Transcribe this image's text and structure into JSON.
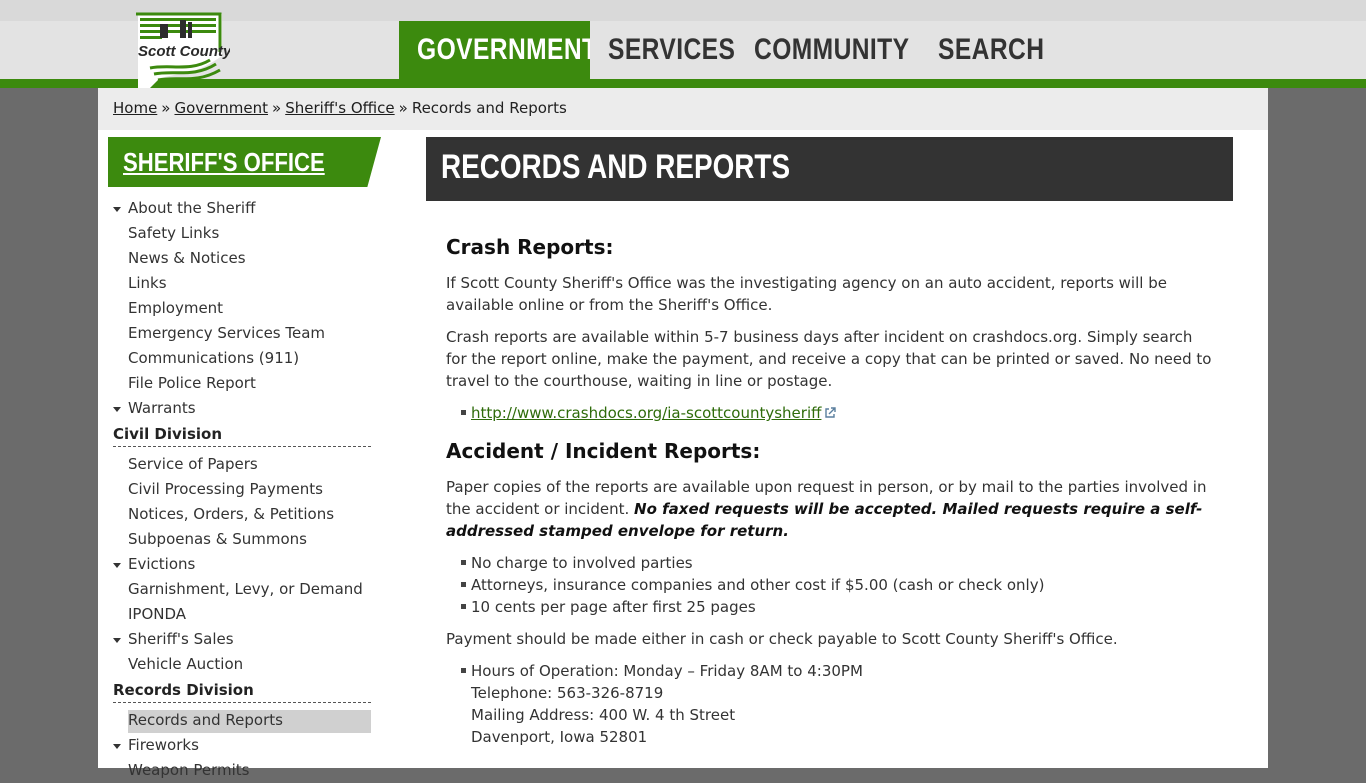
{
  "brand": {
    "logo_text": "Scott County"
  },
  "nav": {
    "items": [
      {
        "label": "GOVERNMENT",
        "active": true
      },
      {
        "label": "SERVICES",
        "active": false
      },
      {
        "label": "COMMUNITY",
        "active": false
      },
      {
        "label": "SEARCH",
        "active": false
      }
    ]
  },
  "breadcrumb": {
    "items": [
      "Home",
      "Government",
      "Sheriff's Office"
    ],
    "current": "Records and Reports",
    "separator": "»"
  },
  "sidebar": {
    "title": "SHERIFF'S OFFICE",
    "items": [
      {
        "label": "About the Sheriff",
        "caret": true
      },
      {
        "label": "Safety Links"
      },
      {
        "label": "News & Notices"
      },
      {
        "label": "Links"
      },
      {
        "label": "Employment"
      },
      {
        "label": "Emergency Services Team"
      },
      {
        "label": "Communications (911)"
      },
      {
        "label": "File Police Report"
      },
      {
        "label": "Warrants",
        "caret": true
      }
    ],
    "civil_heading": "Civil Division",
    "civil_items": [
      {
        "label": "Service of Papers"
      },
      {
        "label": "Civil Processing Payments"
      },
      {
        "label": "Notices, Orders, & Petitions"
      },
      {
        "label": "Subpoenas & Summons"
      },
      {
        "label": "Evictions",
        "caret": true
      },
      {
        "label": "Garnishment, Levy, or Demand"
      },
      {
        "label": "IPONDA"
      },
      {
        "label": "Sheriff's Sales",
        "caret": true
      },
      {
        "label": "Vehicle Auction"
      }
    ],
    "records_heading": "Records Division",
    "records_items": [
      {
        "label": "Records and Reports",
        "selected": true
      },
      {
        "label": "Fireworks",
        "caret": true
      },
      {
        "label": "Weapon Permits"
      }
    ]
  },
  "page": {
    "title": "RECORDS AND REPORTS",
    "crash": {
      "heading": "Crash Reports:",
      "p1": "If Scott County Sheriff's Office was the investigating agency on an auto accident, reports will be available online or from the Sheriff's Office.",
      "p2": "Crash reports are available within 5-7 business days after incident on crashdocs.org. Simply search for the report online, make the payment, and receive a copy that can be printed or saved. No need to travel to the courthouse, waiting in line or postage.",
      "link": "http://www.crashdocs.org/ia-scottcountysheriff"
    },
    "accident": {
      "heading": "Accident / Incident Reports:",
      "p1": "Paper copies of the reports are available upon request in person, or by mail to the parties involved in the accident or incident.",
      "p1_emphasis": "No faxed requests will be accepted. Mailed requests require a self-addressed stamped envelope for return.",
      "fees": [
        "No charge to involved parties",
        "Attorneys, insurance companies and other cost if $5.00 (cash or check only)",
        "10 cents per page after first 25 pages"
      ],
      "payment": "Payment should be made either in cash or check payable to Scott County Sheriff's Office.",
      "hours": "Hours of Operation: Monday – Friday 8AM to 4:30PM",
      "telephone": "Telephone: 563-326-8719",
      "mailing": "Mailing Address: 400 W. 4 th Street",
      "city": "Davenport, Iowa 52801"
    }
  },
  "colors": {
    "brand_green": "#3c8a0e",
    "title_bar": "#333333",
    "link_green": "#2e6b0a"
  }
}
